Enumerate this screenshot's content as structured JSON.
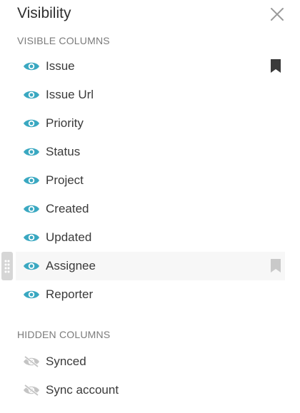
{
  "panel": {
    "title": "Visibility",
    "close_icon": "close-icon"
  },
  "sections": {
    "visible_header": "VISIBLE COLUMNS",
    "hidden_header": "HIDDEN COLUMNS"
  },
  "visible_columns": [
    {
      "label": "Issue",
      "bookmark": "filled"
    },
    {
      "label": "Issue Url",
      "bookmark": "none"
    },
    {
      "label": "Priority",
      "bookmark": "none"
    },
    {
      "label": "Status",
      "bookmark": "none"
    },
    {
      "label": "Project",
      "bookmark": "none"
    },
    {
      "label": "Created",
      "bookmark": "none"
    },
    {
      "label": "Updated",
      "bookmark": "none"
    },
    {
      "label": "Assignee",
      "bookmark": "light"
    },
    {
      "label": "Reporter",
      "bookmark": "none"
    }
  ],
  "hidden_columns": [
    {
      "label": "Synced"
    },
    {
      "label": "Sync account"
    }
  ],
  "colors": {
    "eye_visible": "#3aa8c1",
    "eye_hidden": "#c4c4c4",
    "bookmark_filled": "#3a3a3a",
    "bookmark_light": "#c9c9c9",
    "section_header": "#7b7b7b"
  }
}
